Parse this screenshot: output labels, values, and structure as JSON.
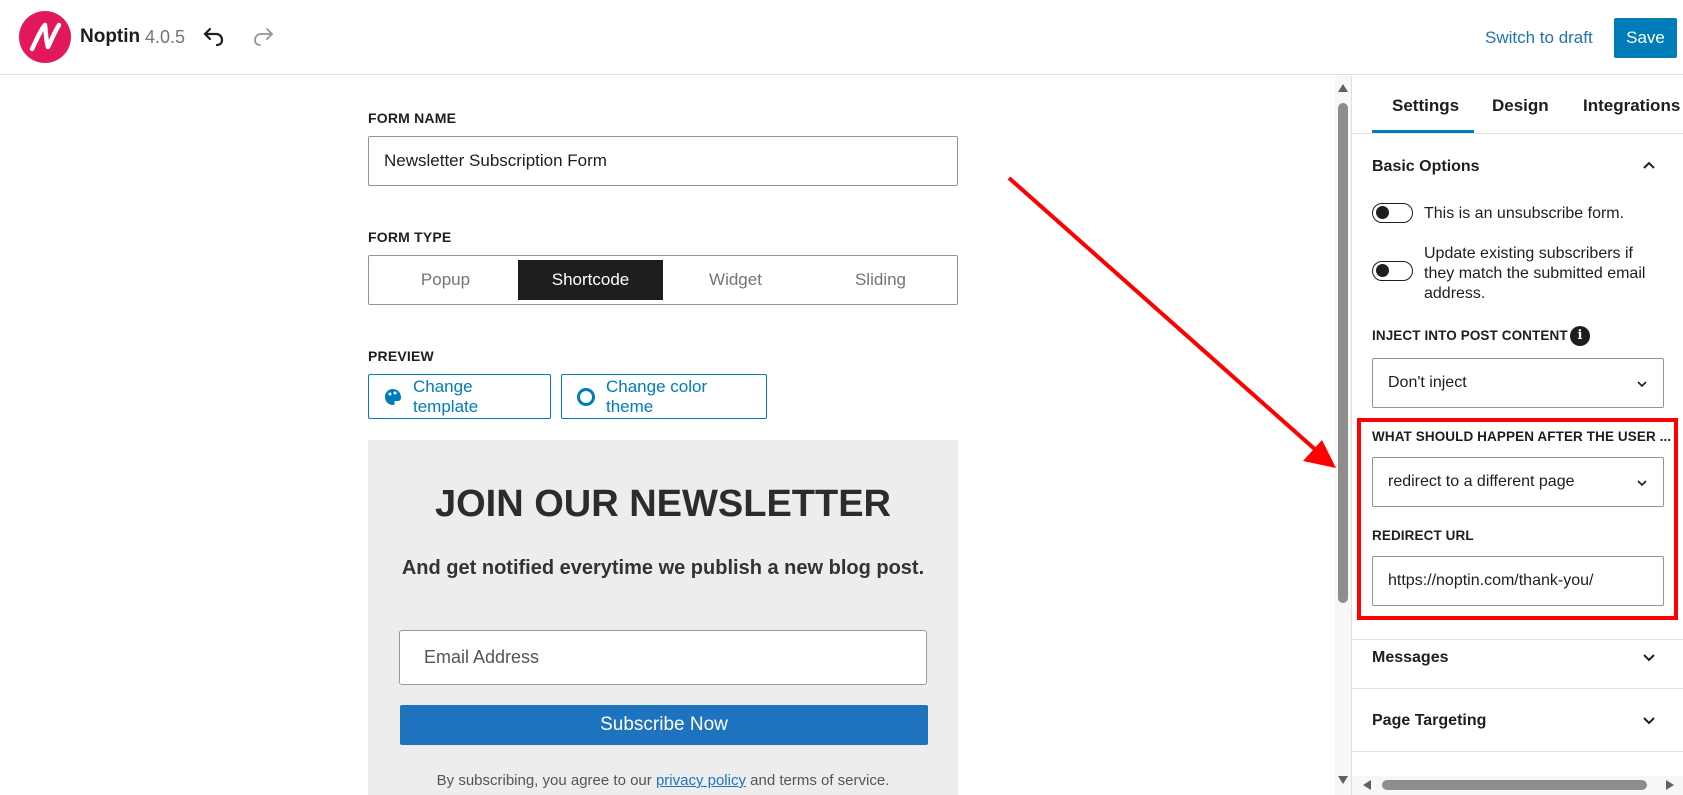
{
  "header": {
    "app_name": "Noptin",
    "version": "4.0.5",
    "switch_draft_label": "Switch to draft",
    "save_label": "Save"
  },
  "form": {
    "name_label": "FORM NAME",
    "name_value": "Newsletter Subscription Form",
    "type_label": "FORM TYPE",
    "types": [
      "Popup",
      "Shortcode",
      "Widget",
      "Sliding"
    ],
    "selected_type": "Shortcode",
    "preview_label": "PREVIEW",
    "change_template_label": "Change template",
    "change_color_label": "Change color theme"
  },
  "preview": {
    "title": "JOIN OUR NEWSLETTER",
    "subtitle": "And get notified everytime we publish a new blog post.",
    "email_placeholder": "Email Address",
    "button_label": "Subscribe Now",
    "note_prefix": "By subscribing, you agree to our ",
    "note_link": "privacy policy",
    "note_suffix": " and terms of service."
  },
  "sidebar": {
    "tabs": [
      "Settings",
      "Design",
      "Integrations"
    ],
    "active_tab": "Settings",
    "basic_options": {
      "title": "Basic Options",
      "toggle_unsubscribe": "This is an unsubscribe form.",
      "toggle_update_line1": "Update existing subscribers if",
      "toggle_update_line2": "they match the submitted email",
      "toggle_update_line3": "address.",
      "inject_label": "INJECT INTO POST CONTENT",
      "inject_value": "Don't inject",
      "after_label": "WHAT SHOULD HAPPEN AFTER THE USER ...",
      "after_value": "redirect to a different page",
      "redirect_label": "REDIRECT URL",
      "redirect_value": "https://noptin.com/thank-you/"
    },
    "messages_title": "Messages",
    "page_targeting_title": "Page Targeting"
  },
  "colors": {
    "accent": "#007cba",
    "logo": "#e2185b",
    "annotation": "#ff0000"
  }
}
